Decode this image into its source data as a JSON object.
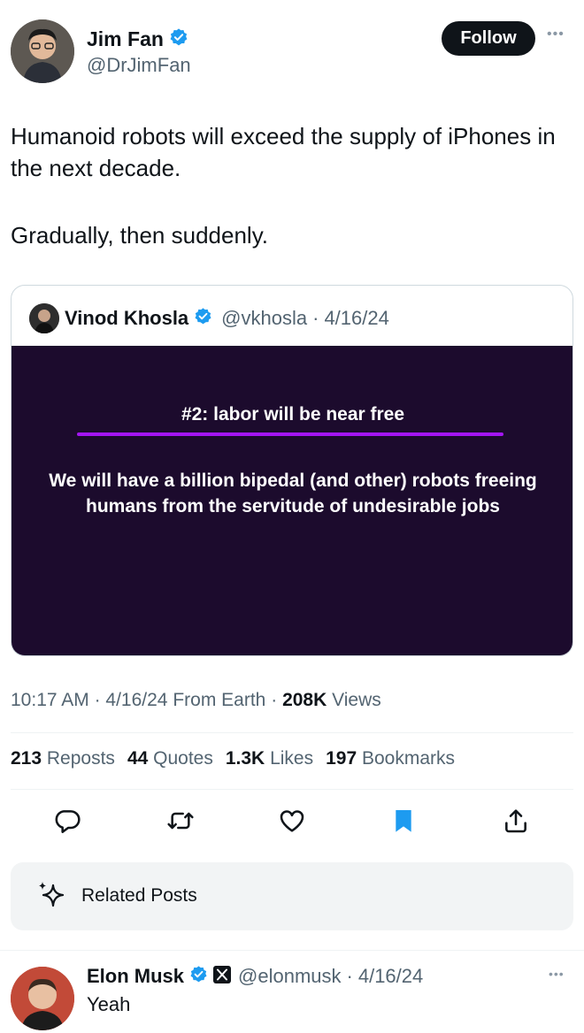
{
  "author": {
    "name": "Jim Fan",
    "handle": "@DrJimFan",
    "follow_label": "Follow",
    "more_label": "•••"
  },
  "tweet": {
    "paragraphs": [
      "Humanoid robots will exceed the supply of iPhones in the next decade.",
      "Gradually, then suddenly."
    ]
  },
  "quote": {
    "name": "Vinod Khosla",
    "handle": "@vkhosla",
    "separator": "·",
    "date": "4/16/24",
    "slide_title": "#2: labor will be near free",
    "slide_body": "We will have a billion bipedal (and other) robots freeing humans from the servitude of undesirable jobs",
    "slide_bg": "#1c0b2d",
    "slide_accent": "#a415f5"
  },
  "meta": {
    "time": "10:17 AM",
    "date": "4/16/24",
    "source": "From Earth",
    "views_count": "208K",
    "views_label": "Views",
    "separator": "·"
  },
  "stats": [
    {
      "count": "213",
      "label": "Reposts"
    },
    {
      "count": "44",
      "label": "Quotes"
    },
    {
      "count": "1.3K",
      "label": "Likes"
    },
    {
      "count": "197",
      "label": "Bookmarks"
    }
  ],
  "actions": [
    "reply-icon",
    "repost-icon",
    "like-icon",
    "bookmark-icon",
    "share-icon"
  ],
  "colors": {
    "verified": "#1d9bf0",
    "bookmark": "#1d9bf0",
    "text": "#0f1419",
    "muted": "#536471"
  },
  "related": {
    "label": "Related Posts"
  },
  "reply": {
    "name": "Elon Musk",
    "handle": "@elonmusk",
    "separator": "·",
    "date": "4/16/24",
    "text": "Yeah",
    "more_label": "•••"
  }
}
